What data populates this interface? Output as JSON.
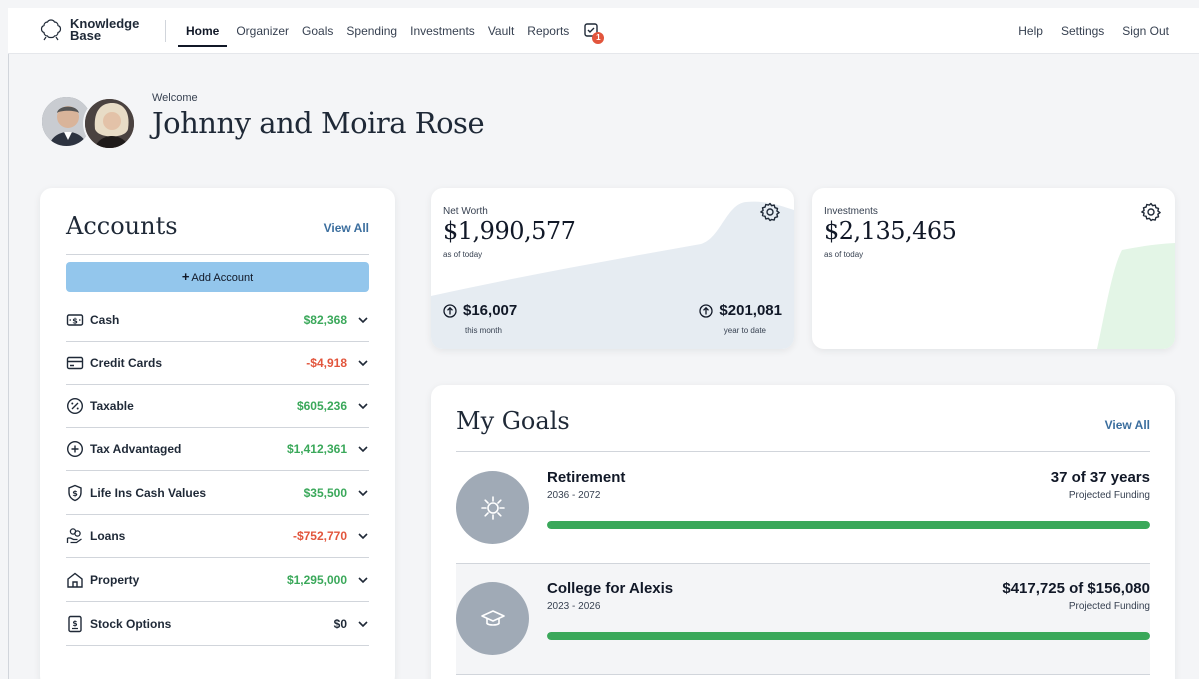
{
  "nav": {
    "logo_line1": "Knowledge",
    "logo_line2": "Base",
    "links": [
      "Home",
      "Organizer",
      "Goals",
      "Spending",
      "Investments",
      "Vault",
      "Reports"
    ],
    "tasks_badge": "1",
    "right_links": [
      "Help",
      "Settings",
      "Sign Out"
    ]
  },
  "welcome": {
    "greeting": "Welcome",
    "name": "Johnny and Moira Rose"
  },
  "accounts": {
    "title": "Accounts",
    "view_all": "View All",
    "add_label": "Add Account",
    "items": [
      {
        "label": "Cash",
        "value": "$82,368",
        "tone": "pos",
        "icon": "cash-icon"
      },
      {
        "label": "Credit Cards",
        "value": "-$4,918",
        "tone": "neg",
        "icon": "credit-card-icon"
      },
      {
        "label": "Taxable",
        "value": "$605,236",
        "tone": "pos",
        "icon": "percent-icon"
      },
      {
        "label": "Tax Advantaged",
        "value": "$1,412,361",
        "tone": "pos",
        "icon": "plus-circle-icon"
      },
      {
        "label": "Life Ins Cash Values",
        "value": "$35,500",
        "tone": "pos",
        "icon": "shield-dollar-icon"
      },
      {
        "label": "Loans",
        "value": "-$752,770",
        "tone": "neg",
        "icon": "hand-coins-icon"
      },
      {
        "label": "Property",
        "value": "$1,295,000",
        "tone": "pos",
        "icon": "house-icon"
      },
      {
        "label": "Stock Options",
        "value": "$0",
        "tone": "zero",
        "icon": "document-dollar-icon"
      }
    ]
  },
  "net_worth": {
    "label": "Net Worth",
    "value": "$1,990,577",
    "as_of": "as of today",
    "month_change": "$16,007",
    "month_label": "this month",
    "ytd_change": "$201,081",
    "ytd_label": "year to date"
  },
  "investments": {
    "label": "Investments",
    "value": "$2,135,465",
    "as_of": "as of today"
  },
  "goals": {
    "title": "My Goals",
    "view_all": "View All",
    "items": [
      {
        "name": "Retirement",
        "years": "2036 - 2072",
        "status": "37 of 37 years",
        "projected": "Projected Funding",
        "progress": 1.0,
        "icon": "sun-icon"
      },
      {
        "name": "College for Alexis",
        "years": "2023 - 2026",
        "status": "$417,725 of $156,080",
        "projected": "Projected Funding",
        "progress": 1.0,
        "icon": "graduation-cap-icon"
      }
    ]
  },
  "colors": {
    "positive": "#3aa85a",
    "negative": "#e2553c",
    "link": "#3b6e9e",
    "add_button": "#93c6ec"
  }
}
